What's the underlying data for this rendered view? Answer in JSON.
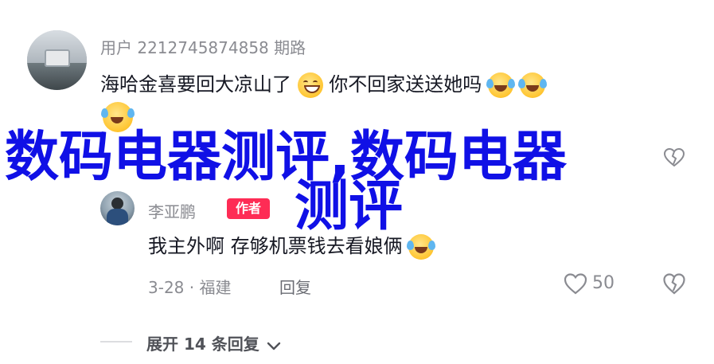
{
  "comment1": {
    "username": "用户 2212745874858 期路",
    "text_part1": "海哈金喜要回大凉山了",
    "text_part2": "你不回家送送她吗"
  },
  "watermark": {
    "line1": "数码电器测评,数码电器",
    "line2": "测评"
  },
  "reply": {
    "username": "李亚鹏",
    "badge": "作者",
    "text": "我主外啊 存够机票钱去看娘俩",
    "date_location": "3-28 · 福建",
    "reply_label": "回复",
    "like_count": "50"
  },
  "expand": {
    "label": "展开 14 条回复"
  },
  "colors": {
    "accent": "#fe2c55",
    "watermark": "#1010e6"
  }
}
